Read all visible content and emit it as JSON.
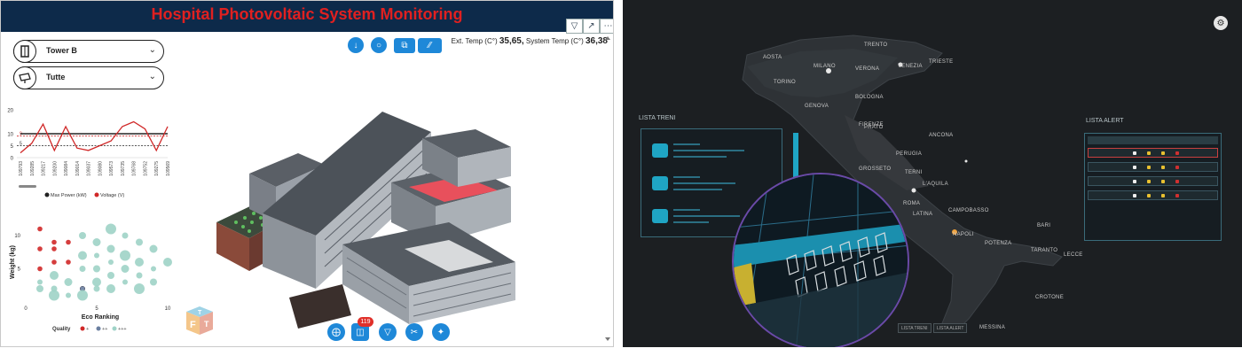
{
  "dashboard": {
    "title": "Hospital Photovoltaic System Monitoring",
    "tower_select": "Tower B",
    "type_select": "Tutte",
    "ext_temp_label": "Ext. Temp (C°)",
    "ext_temp_value": "35,65,",
    "sys_temp_label": "System Temp (C°)",
    "sys_temp_value": "36,38",
    "badge_count": "119",
    "cube_letters": {
      "top": "T",
      "front": "F",
      "side": "T"
    }
  },
  "chart_data": [
    {
      "type": "line",
      "title": "",
      "x": [
        "109793",
        "109285",
        "109217",
        "109200",
        "109084",
        "109014",
        "109037",
        "109080",
        "109573",
        "109735",
        "109768",
        "109752",
        "109275",
        "109569"
      ],
      "series": [
        {
          "name": "Max Power (kW)",
          "values": [
            10,
            10,
            10,
            10,
            10,
            10,
            10,
            10,
            10,
            10,
            10,
            10,
            10,
            10
          ],
          "color": "#222222"
        },
        {
          "name": "Voltage (V)",
          "values": [
            2,
            6,
            14,
            3,
            13,
            4,
            3,
            5,
            7,
            13,
            15,
            12,
            3,
            13
          ],
          "color": "#d02828"
        }
      ],
      "reference_lines": [
        {
          "value": 9,
          "label": "9",
          "color": "#d02828"
        },
        {
          "value": 5,
          "label": "5",
          "color": "#222222"
        }
      ],
      "yticks": [
        "20",
        "10",
        "5",
        "0"
      ],
      "ylim": [
        0,
        20
      ],
      "legend": "bottom"
    },
    {
      "type": "scatter",
      "title": "",
      "xlabel": "Eco Ranking",
      "ylabel": "Weight (kg)",
      "xticks": [
        "0",
        "5",
        "10"
      ],
      "yticks": [
        "10",
        "5"
      ],
      "xlim": [
        0,
        10
      ],
      "ylim": [
        0,
        12
      ],
      "legend_title": "Quality",
      "legend": "bottom",
      "series": [
        {
          "name": "+",
          "color": "#d02828",
          "points": [
            [
              1,
              11
            ],
            [
              1,
              8
            ],
            [
              2,
              9
            ],
            [
              2,
              6
            ],
            [
              3,
              9
            ],
            [
              3,
              6
            ],
            [
              1,
              5
            ],
            [
              2,
              8
            ]
          ]
        },
        {
          "name": "++",
          "color": "#6a7fa0",
          "points": [
            [
              4,
              2
            ]
          ]
        },
        {
          "name": "+++",
          "color": "#9fd3c7",
          "points": [
            [
              1,
              3
            ],
            [
              1,
              2
            ],
            [
              2,
              4
            ],
            [
              2,
              2
            ],
            [
              2,
              1
            ],
            [
              3,
              3
            ],
            [
              3,
              1
            ],
            [
              4,
              10
            ],
            [
              4,
              7
            ],
            [
              4,
              5
            ],
            [
              4,
              1
            ],
            [
              5,
              9
            ],
            [
              5,
              7
            ],
            [
              5,
              5
            ],
            [
              5,
              3
            ],
            [
              5,
              2
            ],
            [
              6,
              11
            ],
            [
              6,
              8
            ],
            [
              6,
              6
            ],
            [
              6,
              4
            ],
            [
              6,
              2
            ],
            [
              7,
              10
            ],
            [
              7,
              7
            ],
            [
              7,
              5
            ],
            [
              7,
              3
            ],
            [
              8,
              9
            ],
            [
              8,
              6
            ],
            [
              8,
              4
            ],
            [
              8,
              2
            ],
            [
              9,
              8
            ],
            [
              9,
              5
            ],
            [
              9,
              3
            ],
            [
              10,
              6
            ]
          ]
        }
      ]
    }
  ],
  "map": {
    "cities": [
      {
        "name": "TRENTO"
      },
      {
        "name": "AOSTA"
      },
      {
        "name": "MILANO"
      },
      {
        "name": "VERONA"
      },
      {
        "name": "VENEZIA"
      },
      {
        "name": "TRIESTE"
      },
      {
        "name": "TORINO"
      },
      {
        "name": "BOLOGNA"
      },
      {
        "name": "GENOVA"
      },
      {
        "name": "FIRENZE"
      },
      {
        "name": "PRATO"
      },
      {
        "name": "GROSSETO"
      },
      {
        "name": "PERUGIA"
      },
      {
        "name": "TERNI"
      },
      {
        "name": "L'AQUILA"
      },
      {
        "name": "ROMA"
      },
      {
        "name": "LATINA"
      },
      {
        "name": "CAMPOBASSO"
      },
      {
        "name": "BARI"
      },
      {
        "name": "NAPOLI"
      },
      {
        "name": "POTENZA"
      },
      {
        "name": "TARANTO"
      },
      {
        "name": "LECCE"
      },
      {
        "name": "CROTONE"
      },
      {
        "name": "MESSINA"
      },
      {
        "name": "ANCONA"
      }
    ],
    "trains_title": "LISTA TRENI",
    "alerts_title": "LISTA ALERT",
    "tab_trains": "LISTA TRENI",
    "tab_alerts": "LISTA ALERT"
  }
}
